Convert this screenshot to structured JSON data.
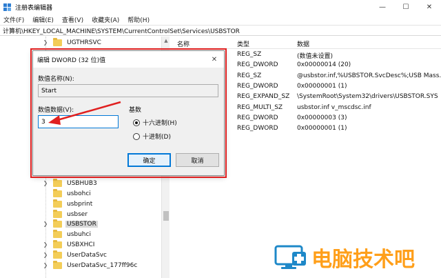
{
  "window": {
    "title": "注册表编辑器",
    "minimize": "—",
    "maximize": "☐",
    "close": "✕"
  },
  "menu": [
    "文件(F)",
    "编辑(E)",
    "查看(V)",
    "收藏夹(A)",
    "帮助(H)"
  ],
  "address": "计算机\\HKEY_LOCAL_MACHINE\\SYSTEM\\CurrentControlSet\\Services\\USBSTOR",
  "tree": [
    {
      "label": "UGTHRSVC",
      "expandable": true
    },
    {
      "label": "USBHUB3",
      "expandable": true
    },
    {
      "label": "usbohci",
      "expandable": false
    },
    {
      "label": "usbprint",
      "expandable": false
    },
    {
      "label": "usbser",
      "expandable": false
    },
    {
      "label": "USBSTOR",
      "expandable": true,
      "selected": true
    },
    {
      "label": "usbuhci",
      "expandable": false
    },
    {
      "label": "USBXHCI",
      "expandable": true
    },
    {
      "label": "UserDataSvc",
      "expandable": true
    },
    {
      "label": "UserDataSvc_177ff96c",
      "expandable": true
    }
  ],
  "list": {
    "headers": {
      "name": "名称",
      "type": "类型",
      "data": "数据"
    },
    "rows": [
      {
        "type": "REG_SZ",
        "data": "(数值未设置)"
      },
      {
        "type": "REG_DWORD",
        "data": "0x00000014 (20)"
      },
      {
        "type": "REG_SZ",
        "data": "@usbstor.inf,%USBSTOR.SvcDesc%;USB Mass..."
      },
      {
        "type": "REG_DWORD",
        "data": "0x00000001 (1)"
      },
      {
        "type": "REG_EXPAND_SZ",
        "data": "\\SystemRoot\\System32\\drivers\\USBSTOR.SYS"
      },
      {
        "type": "REG_MULTI_SZ",
        "data": "usbstor.inf v_mscdsc.inf"
      },
      {
        "type": "REG_DWORD",
        "data": "0x00000003 (3)"
      },
      {
        "type": "REG_DWORD",
        "data": "0x00000001 (1)"
      }
    ]
  },
  "dialog": {
    "title": "编辑 DWORD (32 位)值",
    "close": "✕",
    "name_label": "数值名称(N):",
    "name_value": "Start",
    "data_label": "数值数据(V):",
    "data_value": "3",
    "base_label": "基数",
    "radio_hex": "十六进制(H)",
    "radio_dec": "十进制(D)",
    "ok": "确定",
    "cancel": "取消"
  },
  "watermark": {
    "text": "电脑技术吧"
  },
  "colors": {
    "highlight": "#e02020",
    "watermark": "#ff9f1a",
    "accent": "#0078d7"
  }
}
